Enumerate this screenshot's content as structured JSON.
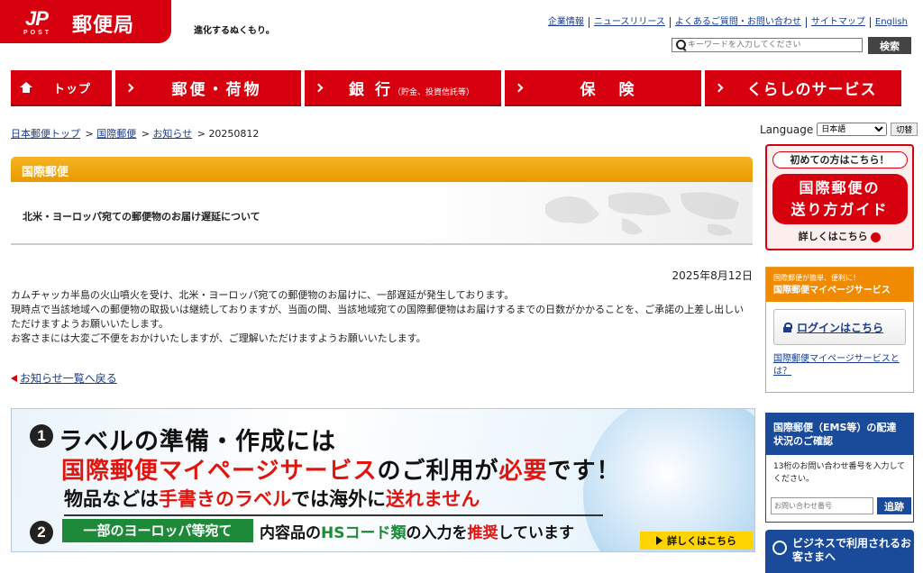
{
  "header": {
    "logo_jp": "JP",
    "logo_post": "POST",
    "logo_name": "郵便局",
    "slogan": "進化するぬくもり。",
    "links": [
      "企業情報",
      "ニュースリリース",
      "よくあるご質問・お問い合わせ",
      "サイトマップ",
      "English"
    ],
    "search_placeholder": "キーワードを入力してください",
    "search_button": "検索"
  },
  "nav": {
    "top": "トップ",
    "yubin": "郵便・荷物",
    "ginko": "銀 行",
    "ginko_sub": "（貯金、投資信託等）",
    "hoken": "保 険",
    "kurashi": "くらしのサービス"
  },
  "breadcrumb": {
    "items": [
      "日本郵便トップ",
      "国際郵便",
      "お知らせ"
    ],
    "current": "20250812"
  },
  "language": {
    "label": "Language",
    "selected": "日本語",
    "button": "切替"
  },
  "section": {
    "header": "国際郵便",
    "title": "北米・ヨーロッパ宛ての郵便物のお届け遅延について"
  },
  "article": {
    "date": "2025年8月12日",
    "lines": [
      "カムチャッカ半島の火山噴火を受け、北米・ヨーロッパ宛ての郵便物のお届けに、一部遅延が発生しております。",
      "現時点で当該地域への郵便物の取扱いは継続しておりますが、当面の間、当該地域宛ての国際郵便物はお届けするまでの日数がかかることを、ご承諾の上差し出しいただけますようお願いいたします。",
      "お客さまには大変ご不便をおかけいたしますが、ご理解いただけますようお願いいたします。"
    ],
    "back_link": "お知らせ一覧へ戻る"
  },
  "banner": {
    "n1": "1",
    "line1": "ラベルの準備・作成には",
    "line2_red": "国際郵便マイページサービス",
    "line2_mid": "のご利用が",
    "line2_red2": "必要",
    "line2_end": "です！",
    "line3_a": "物品などは",
    "line3_red": "手書きのラベル",
    "line3_b": "では海外に",
    "line3_red2": "送れません",
    "n2": "2",
    "green": "一部のヨーロッパ等宛て",
    "line4_a": "内容品の",
    "line4_g": "HSコード類",
    "line4_b": "の入力を",
    "line4_r": "推奨",
    "line4_c": "しています",
    "detail": "詳しくはこちら"
  },
  "sidebar": {
    "guide_top": "初めての方はこちら！",
    "guide_line1": "国際郵便の",
    "guide_line2": "送り方ガイド",
    "guide_more": "詳しくはこちら",
    "mypage_small": "国際郵便が簡単、便利に！",
    "mypage_title": "国際郵便マイページサービス",
    "login": "ログインはこちら",
    "mypage_link": "国際郵便マイページサービスとは？",
    "track_title": "国際郵便（EMS等）の配達状況のご確認",
    "track_desc": "13桁のお問い合わせ番号を入力してください。",
    "track_placeholder": "お問い合わせ番号",
    "track_button": "追跡",
    "business": "ビジネスで利用されるお客さまへ"
  },
  "colors": {
    "brand_red": "#d7000f",
    "section_orange": "#f5b423",
    "navy": "#1a4a9a",
    "banner_green": "#1d8a3a"
  }
}
